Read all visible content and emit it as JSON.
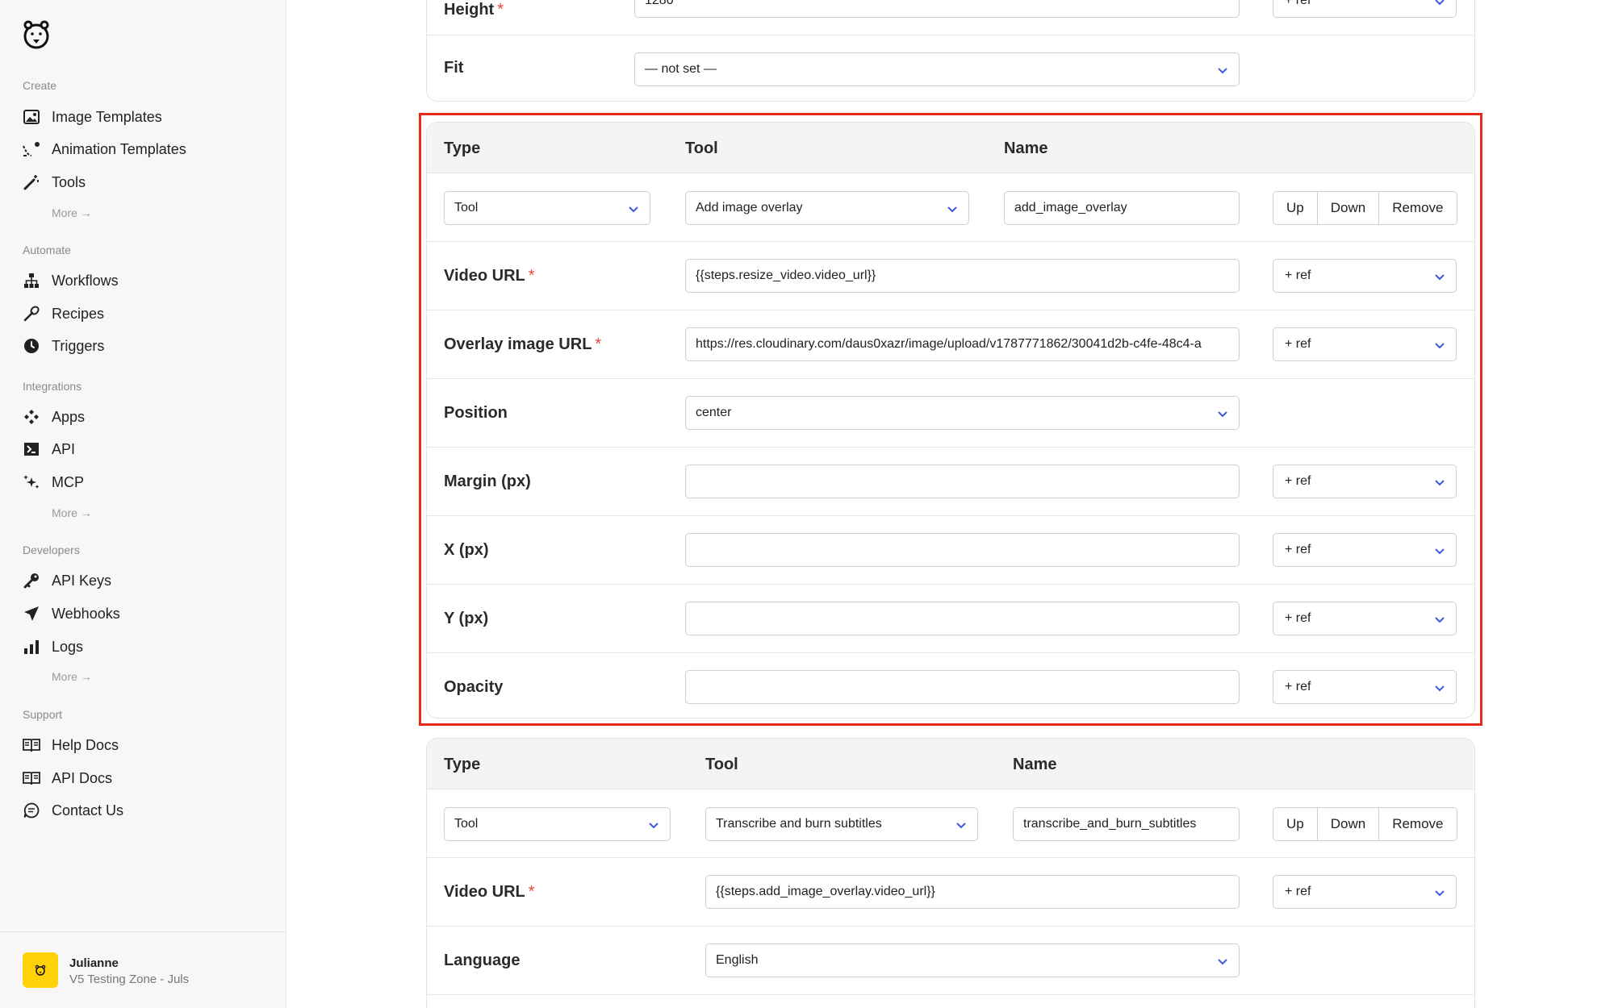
{
  "sidebar": {
    "sections": {
      "create": "Create",
      "automate": "Automate",
      "integrations": "Integrations",
      "developers": "Developers",
      "support": "Support"
    },
    "items": {
      "image_templates": "Image Templates",
      "animation_templates": "Animation Templates",
      "tools": "Tools",
      "workflows": "Workflows",
      "recipes": "Recipes",
      "triggers": "Triggers",
      "apps": "Apps",
      "api": "API",
      "mcp": "MCP",
      "api_keys": "API Keys",
      "webhooks": "Webhooks",
      "logs": "Logs",
      "help_docs": "Help Docs",
      "api_docs": "API Docs",
      "contact_us": "Contact Us"
    },
    "more_label": "More →",
    "user": {
      "name": "Julianne",
      "workspace": "V5 Testing Zone - Juls"
    }
  },
  "top_card": {
    "height_label": "Height",
    "height_value": "1280",
    "fit_label": "Fit",
    "fit_value": "— not set —",
    "ref_label": "+ ref"
  },
  "step_overlay": {
    "headers": {
      "type": "Type",
      "tool": "Tool",
      "name": "Name"
    },
    "type_value": "Tool",
    "tool_value": "Add image overlay",
    "name_value": "add_image_overlay",
    "buttons": {
      "up": "Up",
      "down": "Down",
      "remove": "Remove"
    },
    "fields": {
      "video_url_label": "Video URL",
      "video_url_value": "{{steps.resize_video.video_url}}",
      "overlay_url_label": "Overlay image URL",
      "overlay_url_value": "https://res.cloudinary.com/daus0xazr/image/upload/v1787771862/30041d2b-c4fe-48c4-a",
      "position_label": "Position",
      "position_value": "center",
      "margin_label": "Margin (px)",
      "x_label": "X (px)",
      "y_label": "Y (px)",
      "opacity_label": "Opacity",
      "ref_label": "+ ref",
      "required_mark": "*"
    }
  },
  "step_subtitles": {
    "headers": {
      "type": "Type",
      "tool": "Tool",
      "name": "Name"
    },
    "type_value": "Tool",
    "tool_value": "Transcribe and burn subtitles",
    "name_value": "transcribe_and_burn_subtitles",
    "buttons": {
      "up": "Up",
      "down": "Down",
      "remove": "Remove"
    },
    "fields": {
      "video_url_label": "Video URL",
      "video_url_value": "{{steps.add_image_overlay.video_url}}",
      "language_label": "Language",
      "language_value": "English",
      "ref_label": "+ ref",
      "required_mark": "*"
    }
  },
  "colors": {
    "accent": "#3b5bdb",
    "highlight": "#e8291c",
    "avatar": "#ffd20a",
    "required": "#e5483a"
  }
}
